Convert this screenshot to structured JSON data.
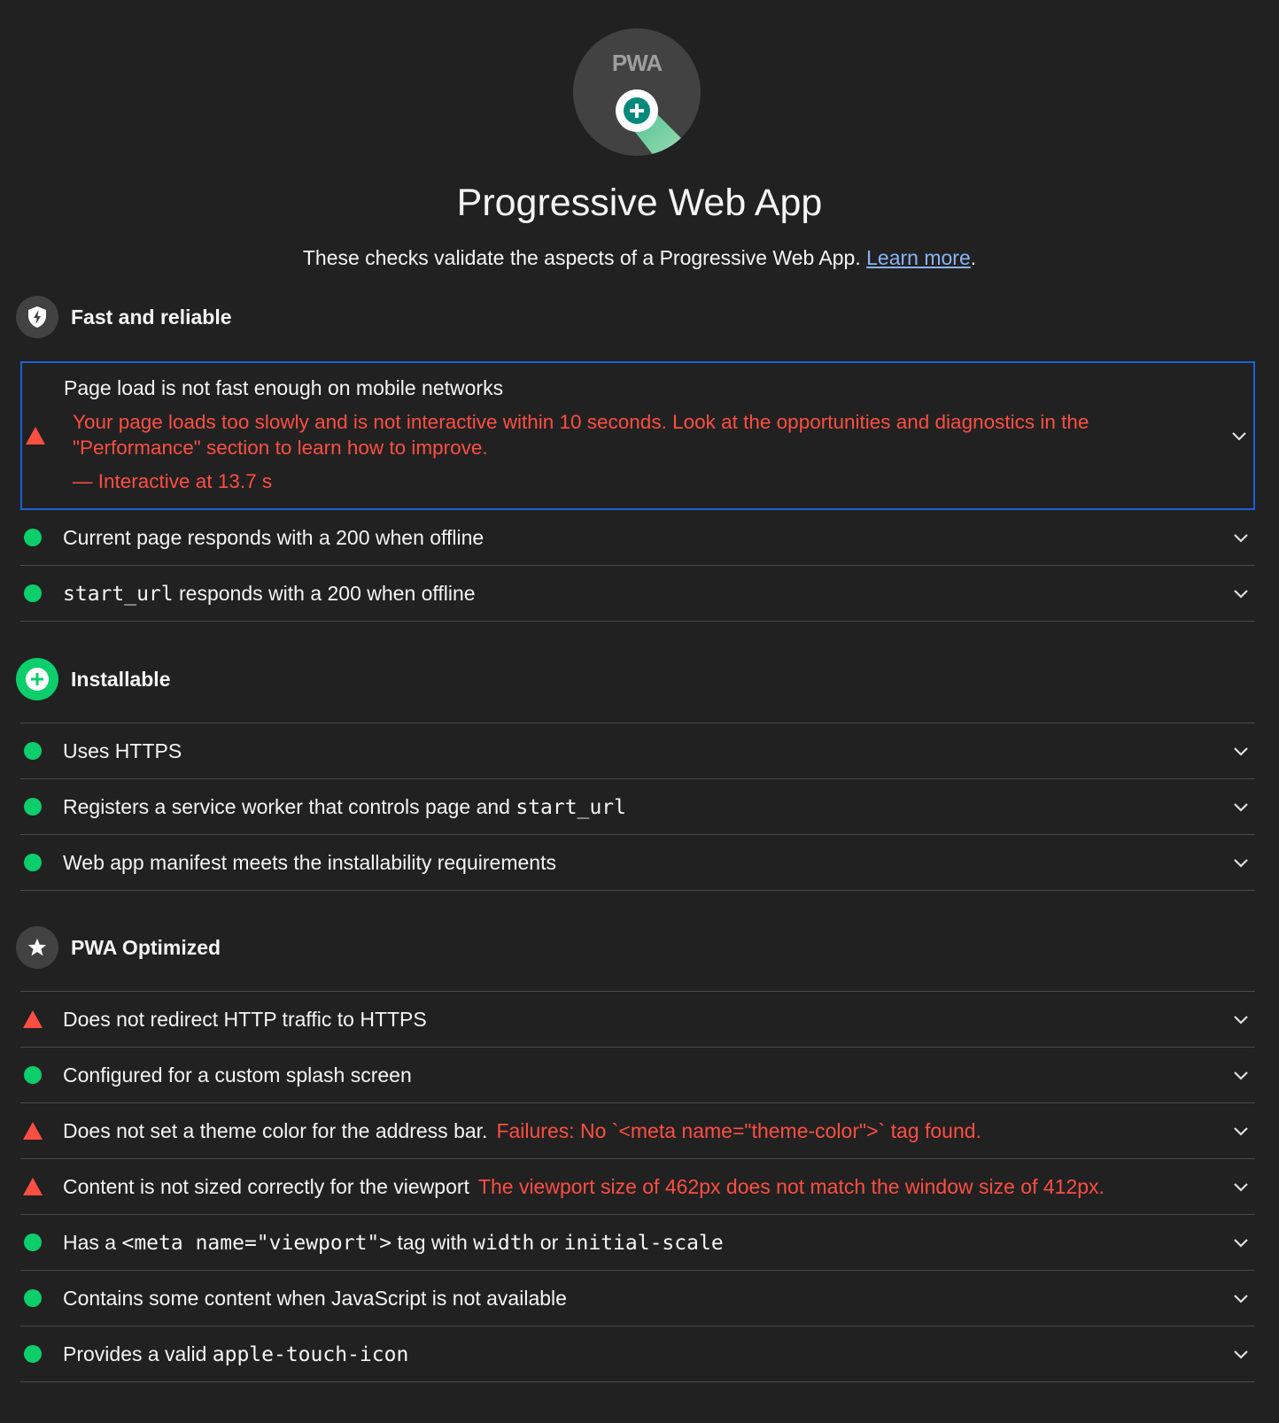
{
  "header": {
    "badge_text": "PWA",
    "title": "Progressive Web App",
    "description": "These checks validate the aspects of a Progressive Web App.",
    "learn_more": "Learn more",
    "period": "."
  },
  "colors": {
    "background": "#212121",
    "pass": "#0cce6b",
    "fail": "#ff4e42",
    "focus_border": "#1a5fd8",
    "link": "#8ab4f8"
  },
  "groups": {
    "fast": {
      "title": "Fast and reliable",
      "icon": "lightning-shield-icon",
      "audits": [
        {
          "status": "fail",
          "title": "Page load is not fast enough on mobile networks",
          "description": "Your page loads too slowly and is not interactive within 10 seconds. Look at the opportunities and diagnostics in the \"Performance\" section to learn how to improve.",
          "value": "— Interactive at 13.7 s"
        },
        {
          "status": "pass",
          "title": "Current page responds with a 200 when offline"
        },
        {
          "status": "pass",
          "code": "start_url",
          "title_rest": " responds with a 200 when offline"
        }
      ]
    },
    "installable": {
      "title": "Installable",
      "icon": "plus-circle-icon",
      "audits": [
        {
          "status": "pass",
          "title": "Uses HTTPS"
        },
        {
          "status": "pass",
          "title": "Registers a service worker that controls page and ",
          "code": "start_url"
        },
        {
          "status": "pass",
          "title": "Web app manifest meets the installability requirements"
        }
      ]
    },
    "optimized": {
      "title": "PWA Optimized",
      "icon": "star-icon",
      "audits": [
        {
          "status": "fail",
          "title": "Does not redirect HTTP traffic to HTTPS"
        },
        {
          "status": "pass",
          "title": "Configured for a custom splash screen"
        },
        {
          "status": "fail",
          "title": "Does not set a theme color for the address bar.",
          "value": "Failures: No `<meta name=\"theme-color\">` tag found."
        },
        {
          "status": "fail",
          "title": "Content is not sized correctly for the viewport",
          "value": "The viewport size of 462px does not match the window size of 412px."
        },
        {
          "status": "pass",
          "t1": "Has a ",
          "c1": "<meta name=\"viewport\">",
          "t2": " tag with ",
          "c2": "width",
          "t3": " or ",
          "c3": "initial-scale"
        },
        {
          "status": "pass",
          "title": "Contains some content when JavaScript is not available"
        },
        {
          "status": "pass",
          "title": "Provides a valid ",
          "code": "apple-touch-icon"
        }
      ]
    }
  }
}
